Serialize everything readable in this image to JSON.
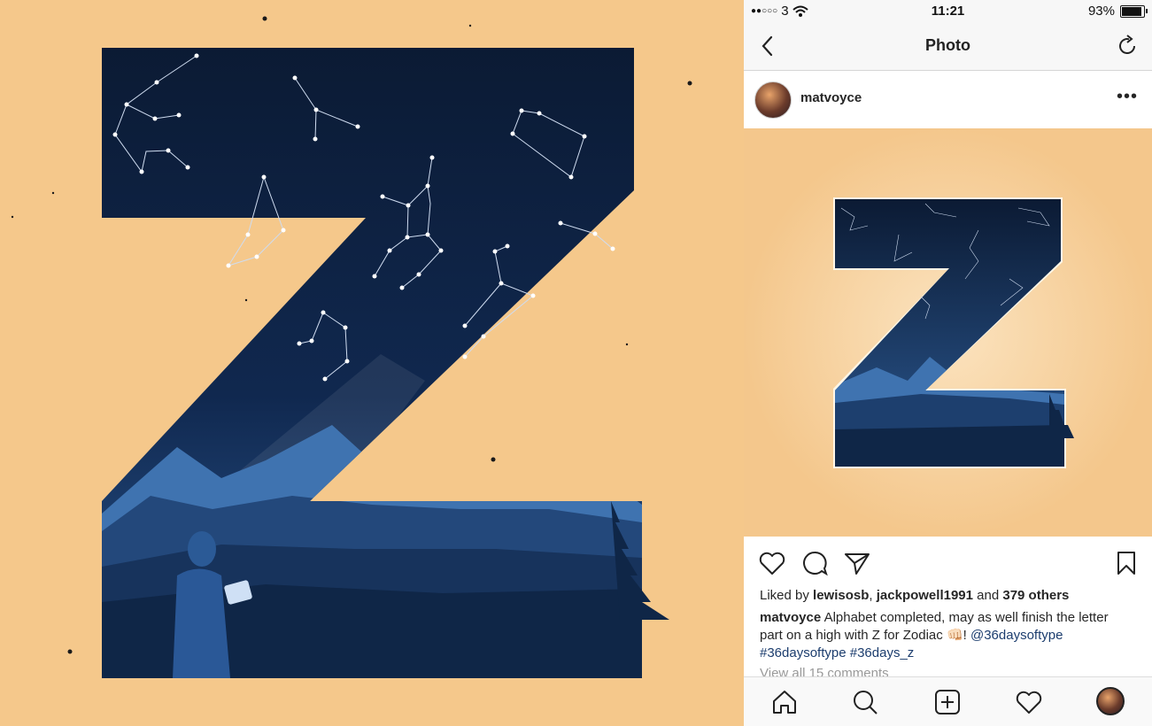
{
  "status_bar": {
    "carrier": "3",
    "time": "11:21",
    "battery": "93%"
  },
  "nav": {
    "title": "Photo"
  },
  "post": {
    "username": "matvoyce",
    "more_label": "•••",
    "likes": {
      "prefix": "Liked by",
      "user1": "lewisosb",
      "separator": ",",
      "user2": "jackpowell1991",
      "and_text": "and",
      "others": "379 others"
    },
    "caption": {
      "username": "matvoyce",
      "text": "Alphabet completed, may as well finish the letter part on a high with Z for Zodiac 👊🏻!",
      "mention": "@36daysoftype",
      "tags": "#36daysoftype #36days_z"
    },
    "view_comments": "View all 15 comments"
  },
  "icons": {
    "back": "chevron-left-icon",
    "refresh": "refresh-icon",
    "like": "heart-icon",
    "comment": "comment-icon",
    "share": "send-icon",
    "save": "bookmark-icon",
    "home": "home-icon",
    "search": "search-icon",
    "add": "add-icon",
    "activity": "heart-icon",
    "profile": "avatar"
  },
  "colors": {
    "background": "#f5c88b",
    "sky": "#0b1a33",
    "link": "#1c3d6e"
  }
}
